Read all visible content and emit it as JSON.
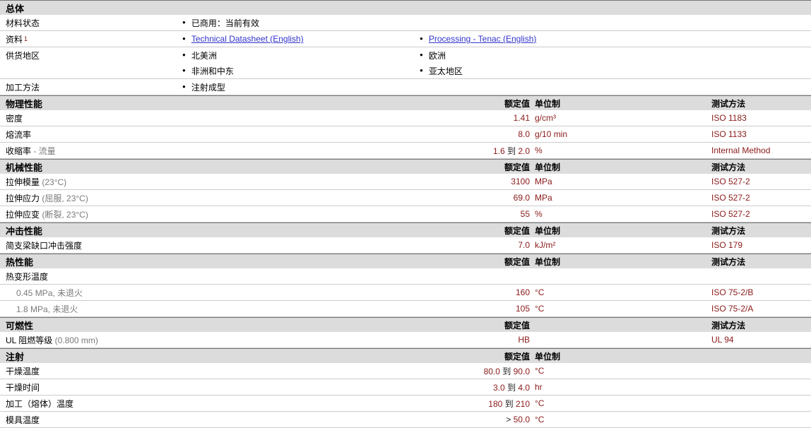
{
  "colors": {
    "value_text": "#8B1A1A",
    "link": "#3333CC",
    "band_bg": "#DCDCDC",
    "band_border": "#777777",
    "row_border": "#CCCCCC",
    "condition_text": "#7A7A7A",
    "connector_text": "#222222"
  },
  "general_section": {
    "title": "总体",
    "rows": [
      {
        "label": "材料状态",
        "col1": [
          {
            "text": "已商用：当前有效"
          }
        ],
        "col2": []
      },
      {
        "label": "资料",
        "sup": "1",
        "col1": [
          {
            "text": "Technical Datasheet (English)",
            "link": true
          }
        ],
        "col2": [
          {
            "text": "Processing - Tenac (English)",
            "link": true
          }
        ]
      },
      {
        "label": "供货地区",
        "col1": [
          {
            "text": "北美洲"
          },
          {
            "text": "非洲和中东"
          }
        ],
        "col2": [
          {
            "text": "欧洲"
          },
          {
            "text": "亚太地区"
          }
        ]
      },
      {
        "label": "加工方法",
        "col1": [
          {
            "text": "注射成型"
          }
        ],
        "col2": []
      }
    ]
  },
  "property_sections": [
    {
      "title": "物理性能",
      "headers": {
        "value": "额定值",
        "unit": "单位制",
        "method": "测试方法"
      },
      "rows": [
        {
          "label": "密度",
          "condition": "",
          "value": "1.41",
          "unit": "g/cm³",
          "method": "ISO 1183"
        },
        {
          "label": "熔流率",
          "condition": "",
          "value": "8.0",
          "unit": "g/10 min",
          "method": "ISO 1133"
        },
        {
          "label": "收缩率",
          "condition": "- 流量",
          "value": "1.6 到 2.0",
          "unit": "%",
          "method": "Internal Method"
        }
      ]
    },
    {
      "title": "机械性能",
      "headers": {
        "value": "额定值",
        "unit": "单位制",
        "method": "测试方法"
      },
      "rows": [
        {
          "label": "拉伸模量",
          "condition": "(23°C)",
          "value": "3100",
          "unit": "MPa",
          "method": "ISO 527-2"
        },
        {
          "label": "拉伸应力",
          "condition": "(屈服, 23°C)",
          "value": "69.0",
          "unit": "MPa",
          "method": "ISO 527-2"
        },
        {
          "label": "拉伸应变",
          "condition": "(断裂, 23°C)",
          "value": "55",
          "unit": "%",
          "method": "ISO 527-2"
        }
      ]
    },
    {
      "title": "冲击性能",
      "headers": {
        "value": "额定值",
        "unit": "单位制",
        "method": "测试方法"
      },
      "rows": [
        {
          "label": "简支梁缺口冲击强度",
          "condition": "",
          "value": "7.0",
          "unit": "kJ/m²",
          "method": "ISO 179"
        }
      ]
    },
    {
      "title": "热性能",
      "headers": {
        "value": "额定值",
        "unit": "单位制",
        "method": "测试方法"
      },
      "rows": [
        {
          "label": "热变形温度",
          "condition": "",
          "subheader": true,
          "value": "",
          "unit": "",
          "method": ""
        },
        {
          "label": "",
          "condition": "0.45 MPa, 未退火",
          "indent": true,
          "value": "160",
          "unit": "°C",
          "method": "ISO 75-2/B"
        },
        {
          "label": "",
          "condition": "1.8 MPa, 未退火",
          "indent": true,
          "value": "105",
          "unit": "°C",
          "method": "ISO 75-2/A"
        }
      ]
    },
    {
      "title": "可燃性",
      "headers": {
        "value": "额定值",
        "unit": "",
        "method": "测试方法"
      },
      "rows": [
        {
          "label": "UL 阻燃等级",
          "condition": "(0.800 mm)",
          "value": "HB",
          "unit": "",
          "method": "UL 94"
        }
      ]
    },
    {
      "title": "注射",
      "headers": {
        "value": "额定值",
        "unit": "单位制",
        "method": ""
      },
      "rows": [
        {
          "label": "干燥温度",
          "condition": "",
          "value": "80.0 到 90.0",
          "unit": "°C",
          "method": ""
        },
        {
          "label": "干燥时间",
          "condition": "",
          "value": "3.0 到 4.0",
          "unit": "hr",
          "method": ""
        },
        {
          "label": "加工（熔体）温度",
          "condition": "",
          "value": "180 到 210",
          "unit": "°C",
          "method": ""
        },
        {
          "label": "模具温度",
          "condition": "",
          "value": "> 50.0",
          "unit": "°C",
          "method": ""
        }
      ]
    }
  ]
}
